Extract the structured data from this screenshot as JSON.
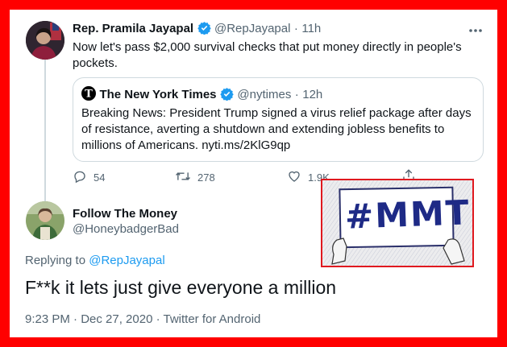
{
  "tweet1": {
    "name": "Rep. Pramila Jayapal",
    "handle": "@RepJayapal",
    "time_sep": "·",
    "time": "11h",
    "text": "Now let's pass $2,000 survival checks that put money directly in people's pockets.",
    "more_icon": "more-icon"
  },
  "quote": {
    "name": "The New York Times",
    "handle": "@nytimes",
    "time_sep": "·",
    "time": "12h",
    "text": "Breaking News: President Trump signed a virus relief package after days of resistance, averting a shutdown and extending jobless benefits to millions of Americans. nyti.ms/2KlG9qp"
  },
  "actions": {
    "replies": "54",
    "retweets": "278",
    "likes": "1.9K"
  },
  "tweet2": {
    "name": "Follow The Money",
    "handle": "@HoneybadgerBad",
    "replying_prefix": "Replying to",
    "replying_to": "@RepJayapal",
    "text": "F**k it lets just give everyone a million",
    "meta": "9:23 PM · Dec 27, 2020 · Twitter for Android"
  },
  "overlay": {
    "sign_text": "#MMT",
    "border_color": "#e0191f"
  },
  "colors": {
    "frame": "#ff0000",
    "accent": "#1d9bf0",
    "text": "#0f1419",
    "muted": "#536471"
  }
}
